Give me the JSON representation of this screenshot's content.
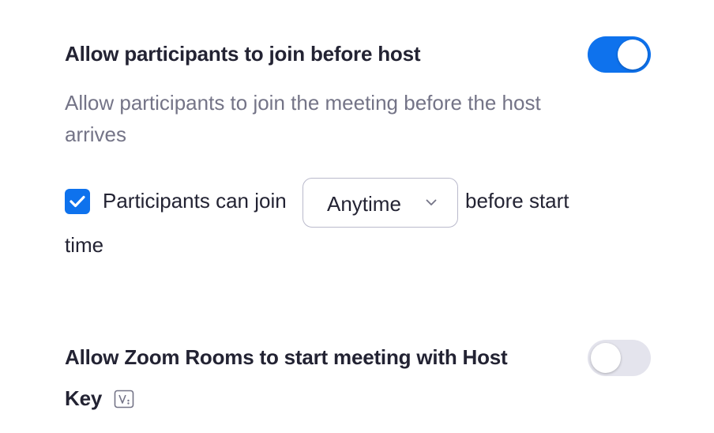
{
  "join_before_host": {
    "title": "Allow participants to join before host",
    "description": "Allow participants to join the meeting before the host arrives",
    "toggle_on": true,
    "checkbox_checked": true,
    "join_label_prefix": "Participants can join",
    "join_label_suffix": "before start",
    "join_label_suffix_wrap": "time",
    "dropdown_selected": "Anytime"
  },
  "zoom_rooms": {
    "title_line1": "Allow Zoom Rooms to start meeting with Host",
    "title_line2": "Key",
    "toggle_on": false,
    "info_icon": "verified-host-key-icon"
  },
  "colors": {
    "accent": "#0e72ed",
    "toggle_off": "#e4e4ed",
    "title_text": "#232333",
    "secondary_text": "#747487",
    "border": "#babacc"
  }
}
